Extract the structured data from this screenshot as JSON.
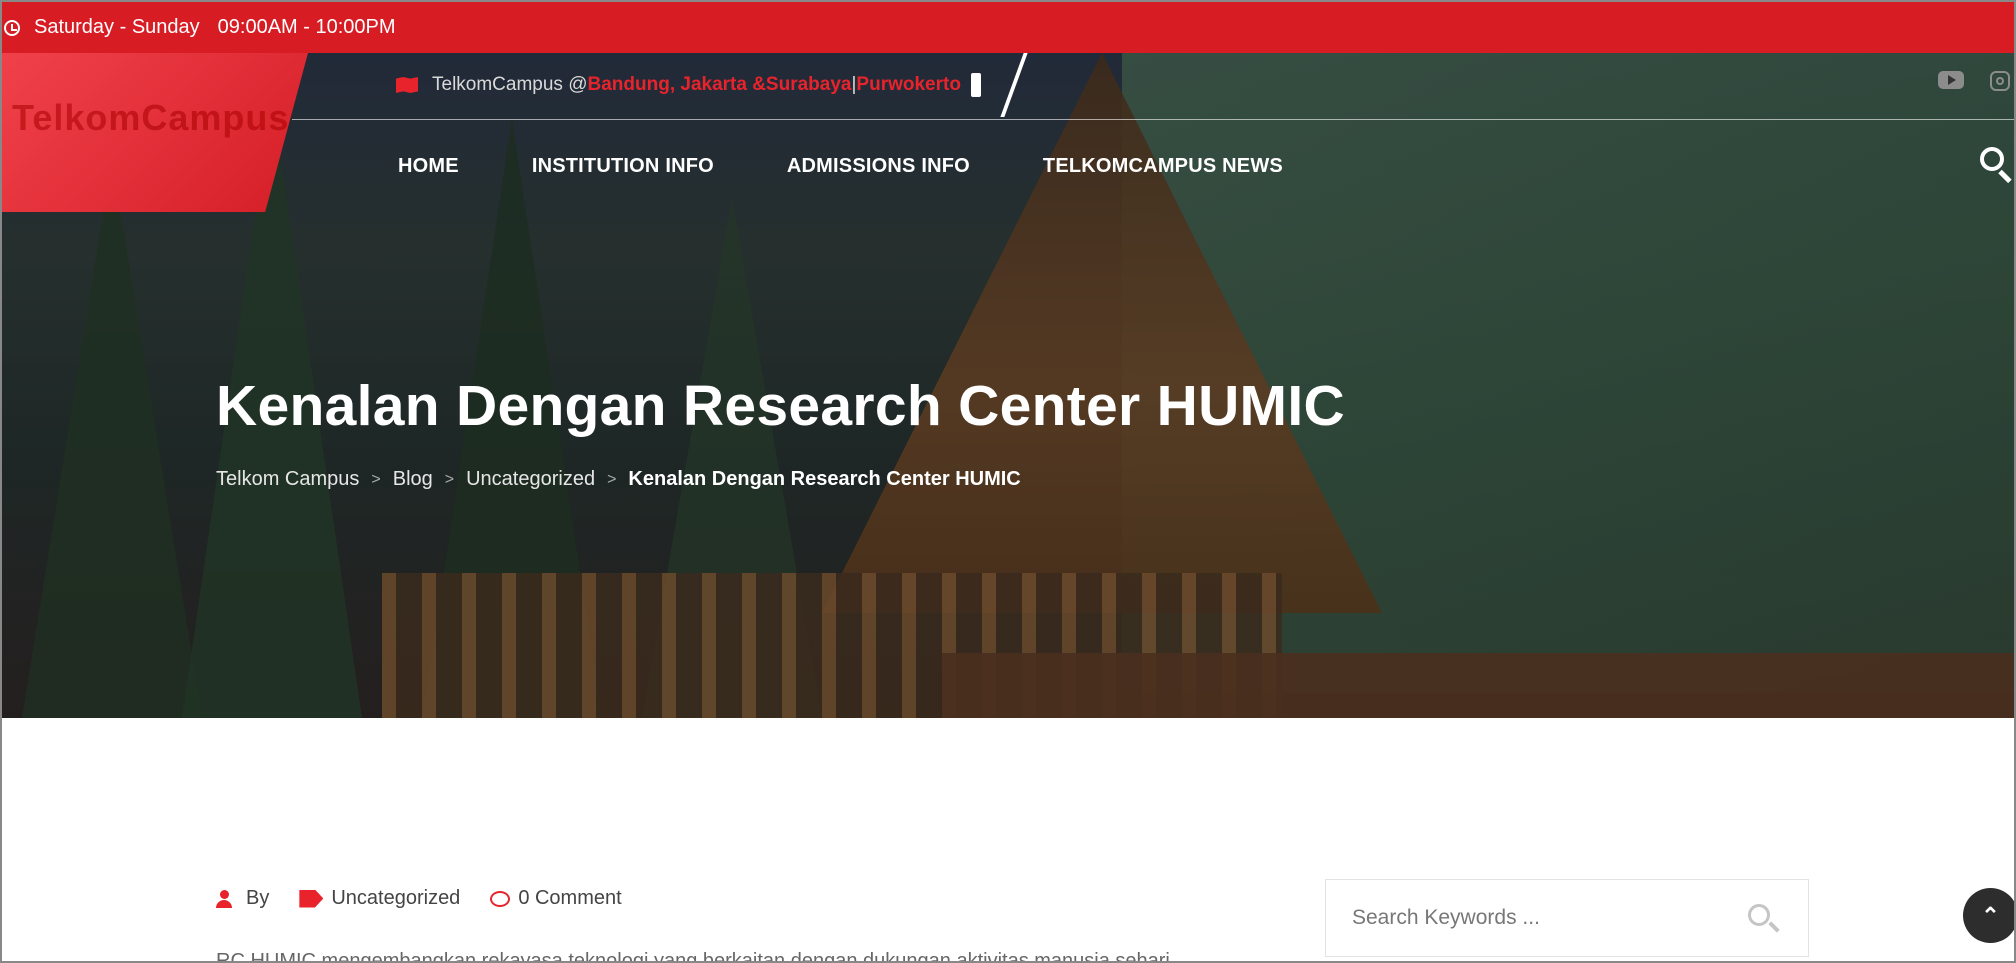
{
  "topbar": {
    "days": "Saturday - Sunday",
    "hours": "09:00AM - 10:00PM"
  },
  "logo": {
    "text": "TelkomCampus"
  },
  "location": {
    "prefix": "TelkomCampus @ ",
    "cities": "Bandung, Jakarta &Surabaya",
    "divider": " | ",
    "extra": "Purwokerto"
  },
  "nav": {
    "items": [
      {
        "label": "HOME"
      },
      {
        "label": "INSTITUTION INFO"
      },
      {
        "label": "ADMISSIONS INFO"
      },
      {
        "label": "TELKOMCAMPUS NEWS"
      }
    ]
  },
  "hero": {
    "title": "Kenalan Dengan Research Center HUMIC",
    "breadcrumb": [
      {
        "label": "Telkom Campus"
      },
      {
        "label": "Blog"
      },
      {
        "label": "Uncategorized"
      },
      {
        "label": "Kenalan Dengan Research Center HUMIC"
      }
    ],
    "separator": ">"
  },
  "post": {
    "author_prefix": "By",
    "category": "Uncategorized",
    "comments": "0 Comment",
    "excerpt": "RC HUMIC mengembangkan rekayasa teknologi yang berkaitan dengan dukungan aktivitas manusia sehari"
  },
  "sidebar": {
    "search_placeholder": "Search Keywords ..."
  },
  "colors": {
    "brand_red": "#d81c24",
    "accent_red": "#e8232b",
    "dark": "#2d2d2d"
  },
  "icons": [
    "clock-icon",
    "map-icon",
    "youtube-icon",
    "instagram-icon",
    "search-icon",
    "user-icon",
    "tags-icon",
    "comment-icon",
    "chevrons-up-icon"
  ]
}
